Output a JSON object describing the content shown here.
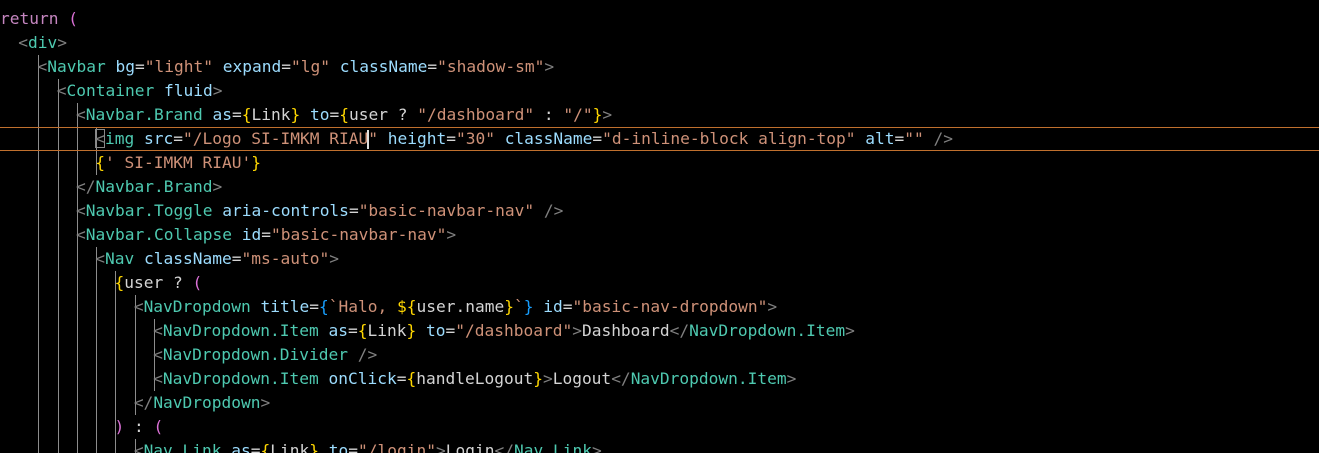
{
  "editor": {
    "theme": {
      "background": "#000000",
      "current_line_border": "#c0702e"
    },
    "lines": [
      {
        "tokens": [
          [
            "kw",
            "return"
          ],
          [
            "op",
            " "
          ],
          [
            "b2",
            "("
          ]
        ]
      },
      {
        "tokens": [
          [
            "pn",
            "<"
          ],
          [
            "tg",
            "div"
          ],
          [
            "pn",
            ">"
          ]
        ]
      },
      {
        "tokens": [
          [
            "pn",
            "<"
          ],
          [
            "tg",
            "Navbar"
          ],
          [
            "op",
            " "
          ],
          [
            "at",
            "bg"
          ],
          [
            "op",
            "="
          ],
          [
            "st",
            "\"light\""
          ],
          [
            "op",
            " "
          ],
          [
            "at",
            "expand"
          ],
          [
            "op",
            "="
          ],
          [
            "st",
            "\"lg\""
          ],
          [
            "op",
            " "
          ],
          [
            "at",
            "className"
          ],
          [
            "op",
            "="
          ],
          [
            "st",
            "\"shadow-sm\""
          ],
          [
            "pn",
            ">"
          ]
        ]
      },
      {
        "tokens": [
          [
            "pn",
            "<"
          ],
          [
            "tg",
            "Container"
          ],
          [
            "op",
            " "
          ],
          [
            "at",
            "fluid"
          ],
          [
            "pn",
            ">"
          ]
        ]
      },
      {
        "tokens": [
          [
            "pn",
            "<"
          ],
          [
            "tg",
            "Navbar.Brand"
          ],
          [
            "op",
            " "
          ],
          [
            "at",
            "as"
          ],
          [
            "op",
            "="
          ],
          [
            "b1",
            "{"
          ],
          [
            "tx",
            "Link"
          ],
          [
            "b1",
            "}"
          ],
          [
            "op",
            " "
          ],
          [
            "at",
            "to"
          ],
          [
            "op",
            "="
          ],
          [
            "b1",
            "{"
          ],
          [
            "tx",
            "user ? "
          ],
          [
            "st",
            "\"/dashboard\""
          ],
          [
            "tx",
            " : "
          ],
          [
            "st",
            "\"/\""
          ],
          [
            "b1",
            "}"
          ],
          [
            "pn",
            ">"
          ]
        ]
      },
      {
        "tokens": [
          [
            "pn",
            "<"
          ],
          [
            "tg",
            "img"
          ],
          [
            "op",
            " "
          ],
          [
            "at",
            "src"
          ],
          [
            "op",
            "="
          ],
          [
            "st",
            "\"/Logo SI-IMKM RIAU"
          ],
          [
            "cursor",
            ""
          ],
          [
            "st",
            "\""
          ],
          [
            "op",
            " "
          ],
          [
            "at",
            "height"
          ],
          [
            "op",
            "="
          ],
          [
            "st",
            "\"30\""
          ],
          [
            "op",
            " "
          ],
          [
            "at",
            "className"
          ],
          [
            "op",
            "="
          ],
          [
            "st",
            "\"d-inline-block align-top\""
          ],
          [
            "op",
            " "
          ],
          [
            "at",
            "alt"
          ],
          [
            "op",
            "="
          ],
          [
            "st",
            "\"\""
          ],
          [
            "op",
            " "
          ],
          [
            "pn",
            "/>"
          ]
        ]
      },
      {
        "tokens": [
          [
            "b1",
            "{"
          ],
          [
            "st",
            "' SI-IMKM RIAU'"
          ],
          [
            "b1",
            "}"
          ]
        ]
      },
      {
        "tokens": [
          [
            "pn",
            "</"
          ],
          [
            "tg",
            "Navbar.Brand"
          ],
          [
            "pn",
            ">"
          ]
        ]
      },
      {
        "tokens": [
          [
            "pn",
            "<"
          ],
          [
            "tg",
            "Navbar.Toggle"
          ],
          [
            "op",
            " "
          ],
          [
            "at",
            "aria-controls"
          ],
          [
            "op",
            "="
          ],
          [
            "st",
            "\"basic-navbar-nav\""
          ],
          [
            "op",
            " "
          ],
          [
            "pn",
            "/>"
          ]
        ]
      },
      {
        "tokens": [
          [
            "pn",
            "<"
          ],
          [
            "tg",
            "Navbar.Collapse"
          ],
          [
            "op",
            " "
          ],
          [
            "at",
            "id"
          ],
          [
            "op",
            "="
          ],
          [
            "st",
            "\"basic-navbar-nav\""
          ],
          [
            "pn",
            ">"
          ]
        ]
      },
      {
        "tokens": [
          [
            "pn",
            "<"
          ],
          [
            "tg",
            "Nav"
          ],
          [
            "op",
            " "
          ],
          [
            "at",
            "className"
          ],
          [
            "op",
            "="
          ],
          [
            "st",
            "\"ms-auto\""
          ],
          [
            "pn",
            ">"
          ]
        ]
      },
      {
        "tokens": [
          [
            "b1",
            "{"
          ],
          [
            "tx",
            "user ? "
          ],
          [
            "b2",
            "("
          ]
        ]
      },
      {
        "tokens": [
          [
            "pn",
            "<"
          ],
          [
            "tg",
            "NavDropdown"
          ],
          [
            "op",
            " "
          ],
          [
            "at",
            "title"
          ],
          [
            "op",
            "="
          ],
          [
            "b3",
            "{"
          ],
          [
            "st",
            "`Halo, "
          ],
          [
            "b1",
            "${"
          ],
          [
            "tx",
            "user.name"
          ],
          [
            "b1",
            "}"
          ],
          [
            "st",
            "`"
          ],
          [
            "b3",
            "}"
          ],
          [
            "op",
            " "
          ],
          [
            "at",
            "id"
          ],
          [
            "op",
            "="
          ],
          [
            "st",
            "\"basic-nav-dropdown\""
          ],
          [
            "pn",
            ">"
          ]
        ]
      },
      {
        "tokens": [
          [
            "pn",
            "<"
          ],
          [
            "tg",
            "NavDropdown.Item"
          ],
          [
            "op",
            " "
          ],
          [
            "at",
            "as"
          ],
          [
            "op",
            "="
          ],
          [
            "b1",
            "{"
          ],
          [
            "tx",
            "Link"
          ],
          [
            "b1",
            "}"
          ],
          [
            "op",
            " "
          ],
          [
            "at",
            "to"
          ],
          [
            "op",
            "="
          ],
          [
            "st",
            "\"/dashboard\""
          ],
          [
            "pn",
            ">"
          ],
          [
            "tx",
            "Dashboard"
          ],
          [
            "pn",
            "</"
          ],
          [
            "tg",
            "NavDropdown.Item"
          ],
          [
            "pn",
            ">"
          ]
        ]
      },
      {
        "tokens": [
          [
            "pn",
            "<"
          ],
          [
            "tg",
            "NavDropdown.Divider"
          ],
          [
            "op",
            " "
          ],
          [
            "pn",
            "/>"
          ]
        ]
      },
      {
        "tokens": [
          [
            "pn",
            "<"
          ],
          [
            "tg",
            "NavDropdown.Item"
          ],
          [
            "op",
            " "
          ],
          [
            "at",
            "onClick"
          ],
          [
            "op",
            "="
          ],
          [
            "b1",
            "{"
          ],
          [
            "tx",
            "handleLogout"
          ],
          [
            "b1",
            "}"
          ],
          [
            "pn",
            ">"
          ],
          [
            "tx",
            "Logout"
          ],
          [
            "pn",
            "</"
          ],
          [
            "tg",
            "NavDropdown.Item"
          ],
          [
            "pn",
            ">"
          ]
        ]
      },
      {
        "tokens": [
          [
            "pn",
            "</"
          ],
          [
            "tg",
            "NavDropdown"
          ],
          [
            "pn",
            ">"
          ]
        ]
      },
      {
        "tokens": [
          [
            "b2",
            ")"
          ],
          [
            "tx",
            " : "
          ],
          [
            "b2",
            "("
          ]
        ]
      },
      {
        "tokens": [
          [
            "pn",
            "<"
          ],
          [
            "tg",
            "Nav.Link"
          ],
          [
            "op",
            " "
          ],
          [
            "at",
            "as"
          ],
          [
            "op",
            "="
          ],
          [
            "b1",
            "{"
          ],
          [
            "tx",
            "Link"
          ],
          [
            "b1",
            "}"
          ],
          [
            "op",
            " "
          ],
          [
            "at",
            "to"
          ],
          [
            "op",
            "="
          ],
          [
            "st",
            "\"/login\""
          ],
          [
            "pn",
            ">"
          ],
          [
            "tx",
            "Login"
          ],
          [
            "pn",
            "</"
          ],
          [
            "tg",
            "Nav.Link"
          ],
          [
            "pn",
            ">"
          ]
        ]
      }
    ]
  }
}
